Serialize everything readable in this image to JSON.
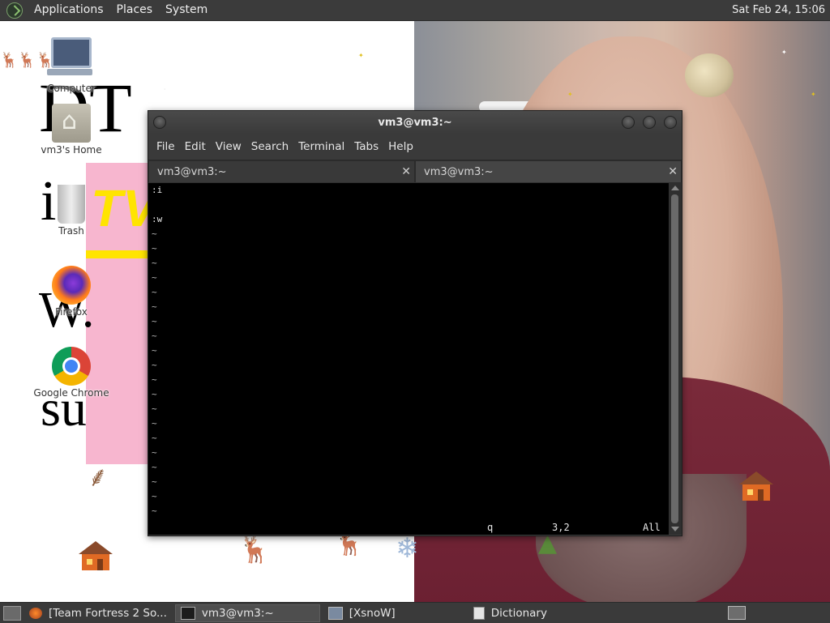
{
  "top_panel": {
    "menus": [
      "Applications",
      "Places",
      "System"
    ],
    "clock": "Sat Feb 24, 15:06"
  },
  "desktop": {
    "icons": [
      {
        "label": "Computer",
        "icon": "computer-icon"
      },
      {
        "label": "vm3's Home",
        "icon": "home-folder-icon"
      },
      {
        "label": "Trash",
        "icon": "trash-icon"
      },
      {
        "label": "Firefox",
        "icon": "firefox-icon"
      },
      {
        "label": "Google Chrome",
        "icon": "chrome-icon"
      }
    ],
    "wallpaper_text": {
      "dt": "DT",
      "tv": "TV",
      "i": "i",
      "w": "W.",
      "su": "su"
    }
  },
  "terminal": {
    "title": "vm3@vm3:~",
    "menu": [
      "File",
      "Edit",
      "View",
      "Search",
      "Terminal",
      "Tabs",
      "Help"
    ],
    "tabs": [
      {
        "label": "vm3@vm3:~",
        "close": "✕",
        "active": true
      },
      {
        "label": "vm3@vm3:~",
        "close": "✕",
        "active": false
      }
    ],
    "lines": [
      ":i",
      "",
      ":w"
    ],
    "empty_marker": "~",
    "status": {
      "command": "q",
      "position": "3,2",
      "scroll": "All"
    }
  },
  "taskbar": {
    "tasks": [
      {
        "label": "[Team Fortress 2 So...",
        "icon": "firefox-icon",
        "active": false
      },
      {
        "label": "vm3@vm3:~",
        "icon": "terminal-icon",
        "active": true
      },
      {
        "label": "[XsnoW]",
        "icon": "window-icon",
        "active": false
      },
      {
        "label": "Dictionary",
        "icon": "dictionary-icon",
        "active": false
      }
    ]
  },
  "colors": {
    "panel": "#3b3b3b",
    "terminal_bg": "#000000",
    "pink_banner": "#f7b6cf",
    "tv_yellow": "#ffe400"
  }
}
